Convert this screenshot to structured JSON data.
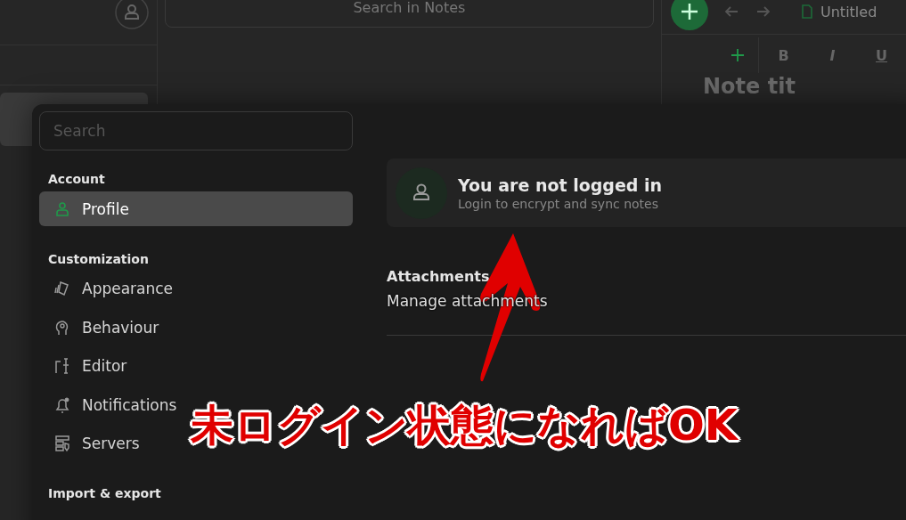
{
  "background_app": {
    "search_placeholder": "Search in Notes",
    "tab_title": "Untitled",
    "toolbar": [
      "B",
      "I",
      "U"
    ],
    "note_title": "Note tit"
  },
  "settings_dialog": {
    "search": {
      "placeholder": "Search"
    },
    "groups": [
      {
        "title": "Account",
        "items": [
          {
            "label": "Profile",
            "selected": true
          }
        ]
      },
      {
        "title": "Customization",
        "items": [
          {
            "label": "Appearance",
            "selected": false
          },
          {
            "label": "Behaviour",
            "selected": false
          },
          {
            "label": "Editor",
            "selected": false
          },
          {
            "label": "Notifications",
            "selected": false
          },
          {
            "label": "Servers",
            "selected": false
          }
        ]
      },
      {
        "title": "Import & export"
      }
    ],
    "profile_card": {
      "title": "You are not logged in",
      "subtitle": "Login to encrypt and sync notes"
    },
    "sections": [
      {
        "title": "Attachments",
        "items": [
          "Manage attachments"
        ]
      }
    ]
  },
  "annotation": {
    "text": "未ログイン状態になればOK"
  }
}
